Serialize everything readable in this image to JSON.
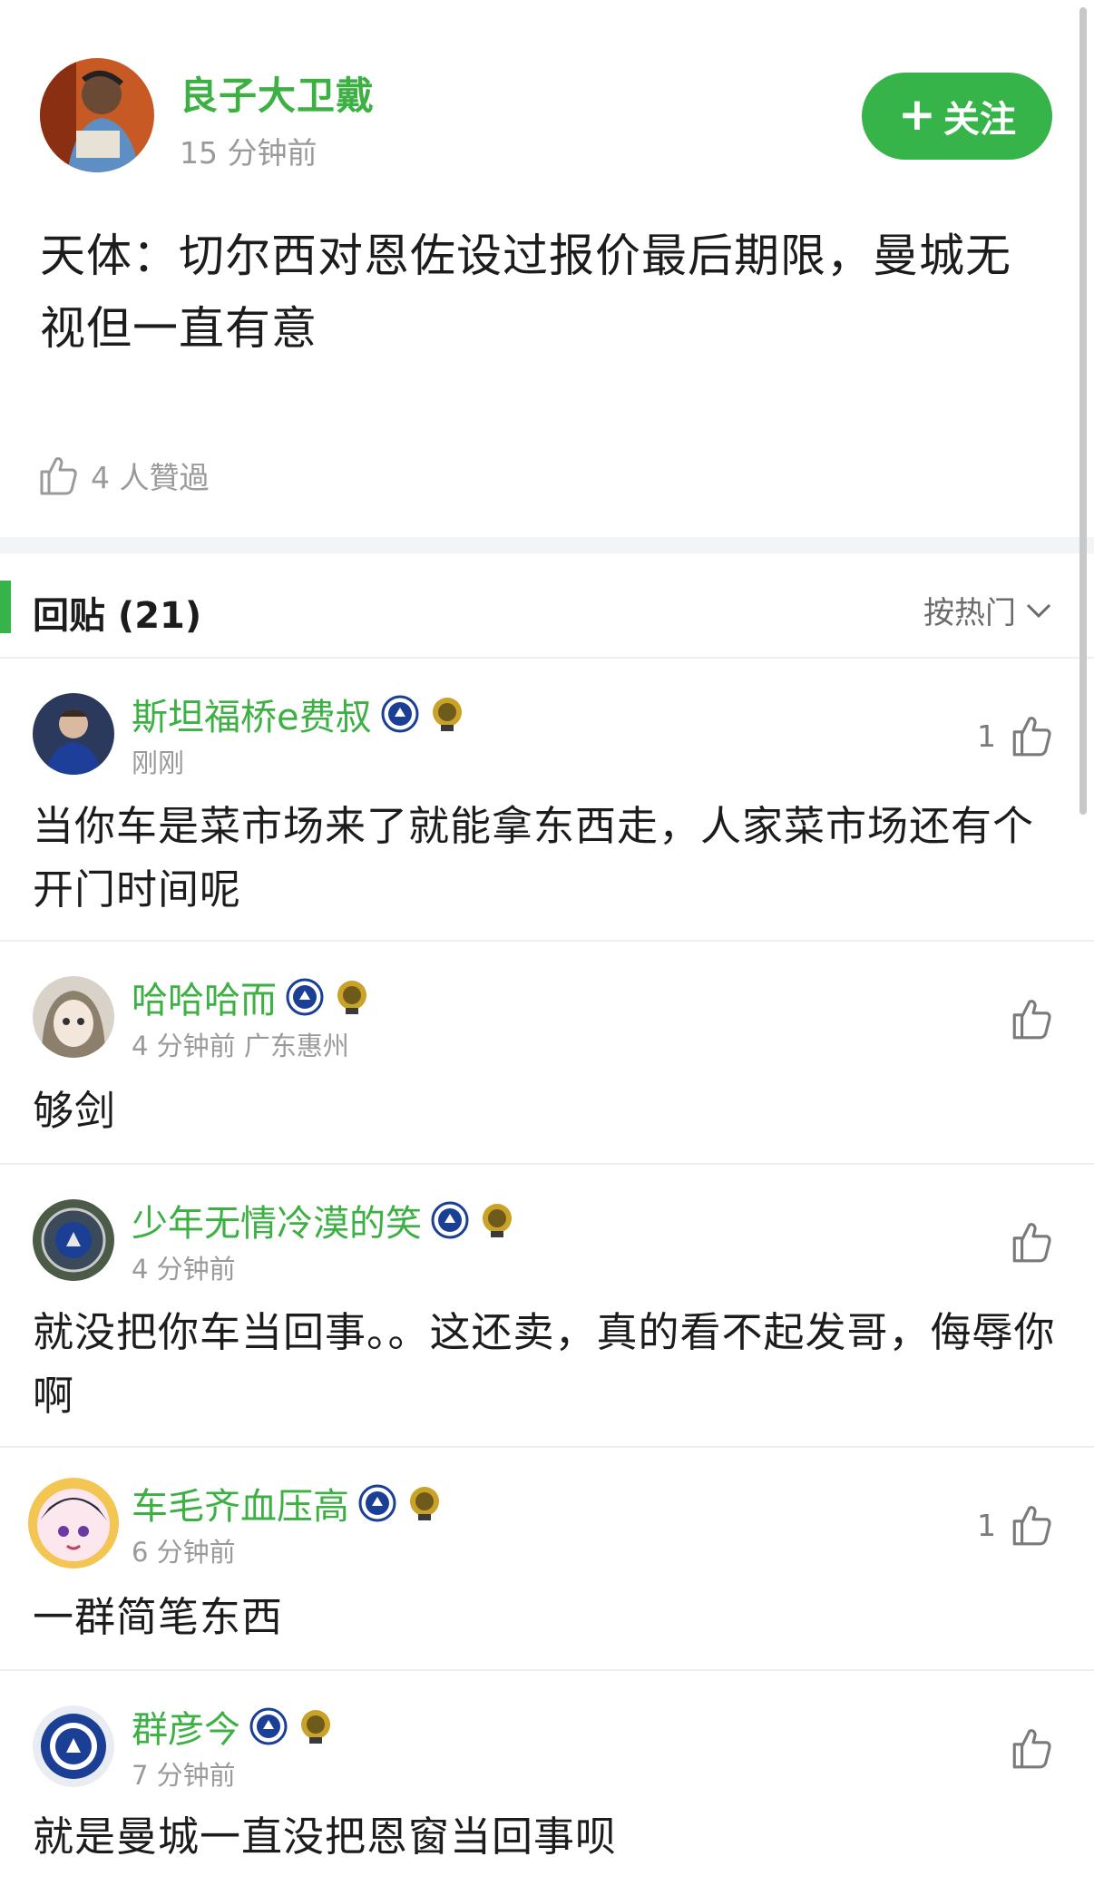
{
  "post": {
    "author": "良子大卫戴",
    "time": "15 分钟前",
    "follow_label": "关注",
    "title": "天体：切尔西对恩佐设过报价最后期限，曼城无视但一直有意",
    "likes_label": "4 人贊過"
  },
  "replies": {
    "header": "回贴 (21)",
    "sort_label": "按热门"
  },
  "comments": [
    {
      "name": "斯坦福桥e费叔",
      "meta": "刚刚",
      "likes": "1",
      "text": "当你车是菜市场来了就能拿东西走，人家菜市场还有个开门时间呢"
    },
    {
      "name": "哈哈哈而",
      "meta": "4 分钟前 广东惠州",
      "likes": "",
      "text": "够剑"
    },
    {
      "name": "少年无情冷漠的笑",
      "meta": "4 分钟前",
      "likes": "",
      "text": "就没把你车当回事。。这还卖，真的看不起发哥，侮辱你啊"
    },
    {
      "name": "车毛齐血压高",
      "meta": "6 分钟前",
      "likes": "1",
      "text": "一群简笔东西"
    },
    {
      "name": "群彦今",
      "meta": "7 分钟前",
      "likes": "",
      "text": "就是曼城一直没把恩窗当回事呗"
    }
  ],
  "colors": {
    "accent": "#36b44a",
    "name_green": "#3cb043",
    "muted": "#9a9a9a",
    "chelsea_blue": "#1b3f94",
    "gold": "#c9a227"
  }
}
